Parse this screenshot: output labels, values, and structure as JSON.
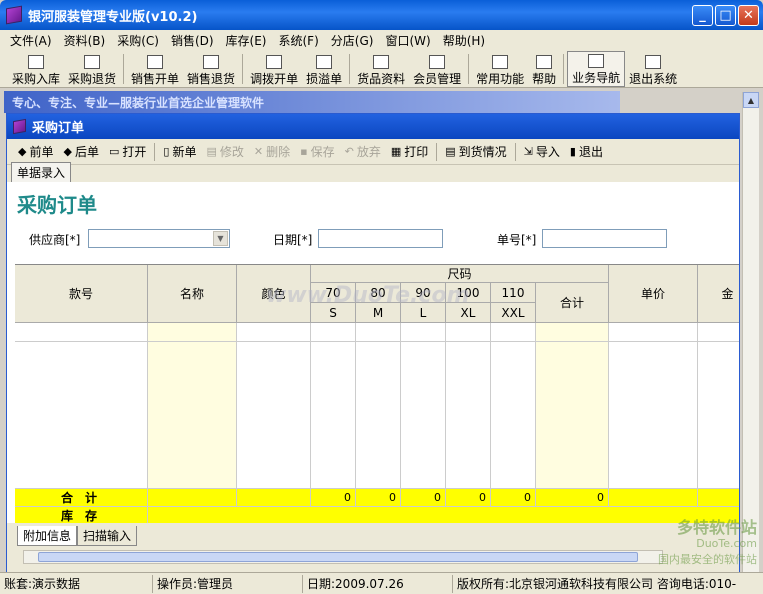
{
  "window": {
    "title": "银河服装管理专业版(v10.2)"
  },
  "menu": [
    "文件(A)",
    "资料(B)",
    "采购(C)",
    "销售(D)",
    "库存(E)",
    "系统(F)",
    "分店(G)",
    "窗口(W)",
    "帮助(H)"
  ],
  "toolbar": [
    "采购入库",
    "采购退货",
    "销售开单",
    "销售退货",
    "调拨开单",
    "损溢单",
    "货品资料",
    "会员管理",
    "常用功能",
    "帮助",
    "业务导航",
    "退出系统"
  ],
  "banner": "专心、专注、专业—服装行业首选企业管理软件",
  "child": {
    "title": "采购订单"
  },
  "form_toolbar": {
    "prev": "前单",
    "next": "后单",
    "open": "打开",
    "new": "新单",
    "edit": "修改",
    "delete": "删除",
    "save": "保存",
    "discard": "放弃",
    "print": "打印",
    "arrival": "到货情况",
    "import": "导入",
    "exit": "退出"
  },
  "tab": "单据录入",
  "form": {
    "title": "采购订单",
    "supplier_label": "供应商[*]",
    "date_label": "日期[*]",
    "no_label": "单号[*]",
    "supplier_value": "",
    "date_value": "",
    "no_value": ""
  },
  "grid": {
    "headers": {
      "style_no": "款号",
      "name": "名称",
      "color": "颜色",
      "size": "尺码",
      "total": "合计",
      "unit_price": "单价",
      "amount": "金"
    },
    "size_codes": [
      "70",
      "80",
      "90",
      "100",
      "110"
    ],
    "size_names": [
      "S",
      "M",
      "L",
      "XL",
      "XXL"
    ],
    "total_row": {
      "label": "合　计",
      "values": [
        "0",
        "0",
        "0",
        "0",
        "0"
      ],
      "sum": "0"
    },
    "stock_row": {
      "label": "库　存"
    }
  },
  "bottom_tabs": [
    "附加信息",
    "扫描输入"
  ],
  "status": {
    "account": "账套:演示数据",
    "operator": "操作员:管理员",
    "date": "日期:2009.07.26",
    "copyright": "版权所有:北京银河通软科技有限公司 咨询电话:010-"
  },
  "watermark": "www.DuoTe.com",
  "watermark_logo": {
    "line1": "多特软件站",
    "line2": "DuoTe.com",
    "line3": "国内最安全的软件站"
  }
}
